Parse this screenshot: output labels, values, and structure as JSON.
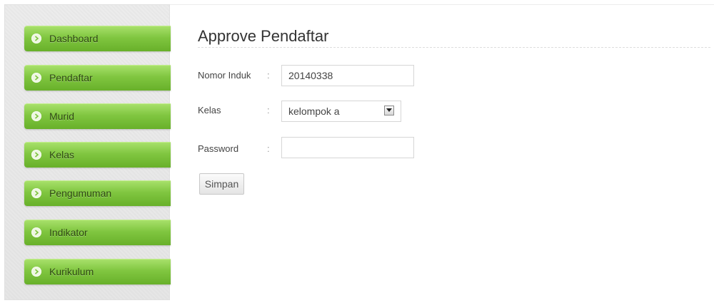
{
  "sidebar": {
    "items": [
      {
        "label": "Dashboard"
      },
      {
        "label": "Pendaftar"
      },
      {
        "label": "Murid"
      },
      {
        "label": "Kelas"
      },
      {
        "label": "Pengumuman"
      },
      {
        "label": "Indikator"
      },
      {
        "label": "Kurikulum"
      }
    ],
    "icon": "chevron-right-icon",
    "accent_color": "#7cc23b"
  },
  "main": {
    "title": "Approve Pendaftar",
    "form": {
      "colon": ":",
      "nomor_induk": {
        "label": "Nomor Induk",
        "value": "20140338"
      },
      "kelas": {
        "label": "Kelas",
        "selected": "kelompok a"
      },
      "password": {
        "label": "Password",
        "value": ""
      },
      "submit_label": "Simpan"
    }
  }
}
